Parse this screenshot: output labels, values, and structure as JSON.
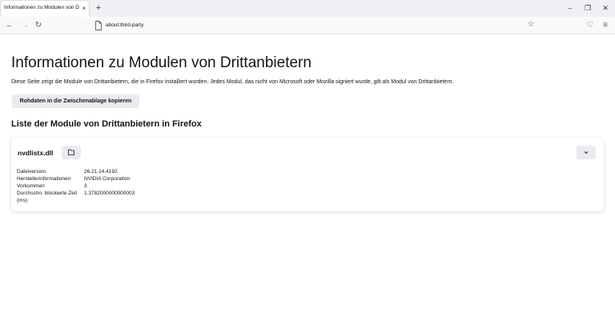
{
  "tab": {
    "title": "Informationen zu Modulen von Drittanbietern",
    "close": "×",
    "new_tab": "+"
  },
  "window": {
    "minimize": "–",
    "maximize": "❐",
    "close": "✕"
  },
  "nav": {
    "back": "←",
    "forward": "→",
    "reload": "↻",
    "url": "about:third-party",
    "star": "☆",
    "pocket": "♡",
    "menu": "≡"
  },
  "page": {
    "title": "Informationen zu Modulen von Drittanbietern",
    "description": "Diese Seite zeigt die Module von Drittanbietern, die in Firefox installiert wurden. Jedes Modul, das nicht von Microsoft oder Mozilla signiert wurde, gilt als Modul von Drittanbietern.",
    "copy_button": "Rohdaten in die Zwischenablage kopieren",
    "section_title": "Liste der Module von Drittanbietern in Firefox"
  },
  "module": {
    "name": "nvdlistx.dll",
    "fields": [
      {
        "label": "Dateiversion",
        "value": "26.21.14.4192"
      },
      {
        "label": "Herstellerinformationen",
        "value": "NVIDIA Corporation"
      },
      {
        "label": "Vorkommen",
        "value": "3"
      },
      {
        "label": "Durchschn. blockierte Zeit (ms)",
        "value": "1.3782000000000003"
      }
    ]
  },
  "icons": {
    "folder": "folder-icon",
    "expand": "chevron-down-icon",
    "url_page": "page-icon"
  }
}
